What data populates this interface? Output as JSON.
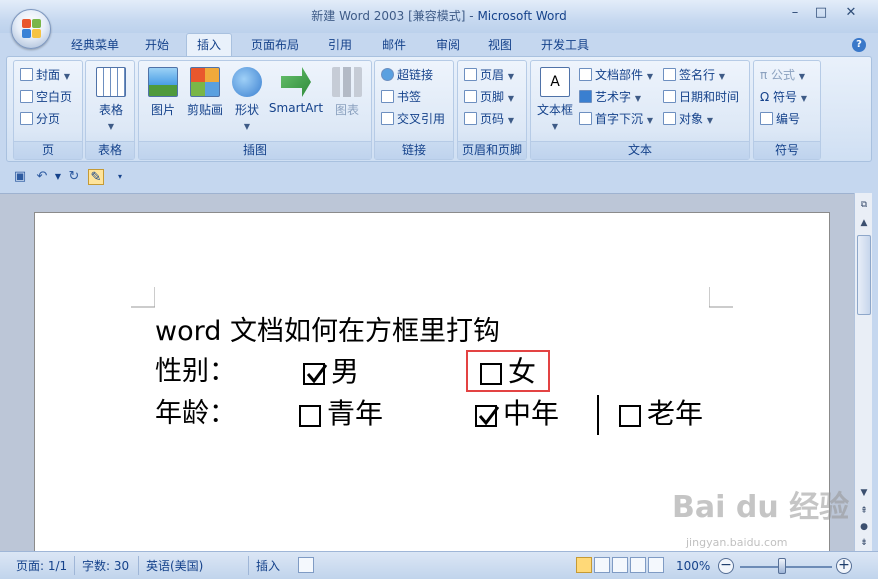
{
  "window": {
    "title_prefix": "新建 Word 2003 [兼容模式] - ",
    "title_app": "Microsoft Word",
    "minimize": "–",
    "maximize": "□",
    "close": "✕"
  },
  "ribbon_tabs": [
    "经典菜单",
    "开始",
    "插入",
    "页面布局",
    "引用",
    "邮件",
    "审阅",
    "视图",
    "开发工具"
  ],
  "active_tab": "插入",
  "help_icon": "?",
  "groups": {
    "pages": {
      "label": "页",
      "items": [
        "封面",
        "空白页",
        "分页"
      ]
    },
    "tables": {
      "label": "表格",
      "button": "表格"
    },
    "illustrations": {
      "label": "插图",
      "buttons": [
        "图片",
        "剪贴画",
        "形状",
        "SmartArt",
        "图表"
      ]
    },
    "links": {
      "label": "链接",
      "items": [
        "超链接",
        "书签",
        "交叉引用"
      ]
    },
    "header_footer": {
      "label": "页眉和页脚",
      "items": [
        "页眉",
        "页脚",
        "页码"
      ]
    },
    "text": {
      "label": "文本",
      "big_button": "文本框",
      "items": [
        "文档部件",
        "艺术字",
        "首字下沉",
        "签名行",
        "日期和时间",
        "对象"
      ]
    },
    "symbols": {
      "label": "符号",
      "items": [
        "公式",
        "符号",
        "编号"
      ]
    }
  },
  "document": {
    "title_line": "word 文档如何在方框里打钩",
    "row1_label": "性别：",
    "row1_opt1": "男",
    "row1_opt2": "女",
    "row2_label": "年龄：",
    "row2_opt1": "青年",
    "row2_opt2": "中年",
    "row2_opt3": "老年"
  },
  "checkbox_states": {
    "男": true,
    "女": false,
    "青年": false,
    "中年": true,
    "老年": false
  },
  "statusbar": {
    "page": "页面: 1/1",
    "words": "字数: 30",
    "language": "英语(美国)",
    "mode": "插入",
    "zoom": "100%"
  },
  "watermark": {
    "main": "Bai du 经验",
    "sub": "jingyan.baidu.com"
  },
  "colors": {
    "highlight": "#e34343",
    "ribbon": "#dbe7f6",
    "accent": "#15428b"
  }
}
